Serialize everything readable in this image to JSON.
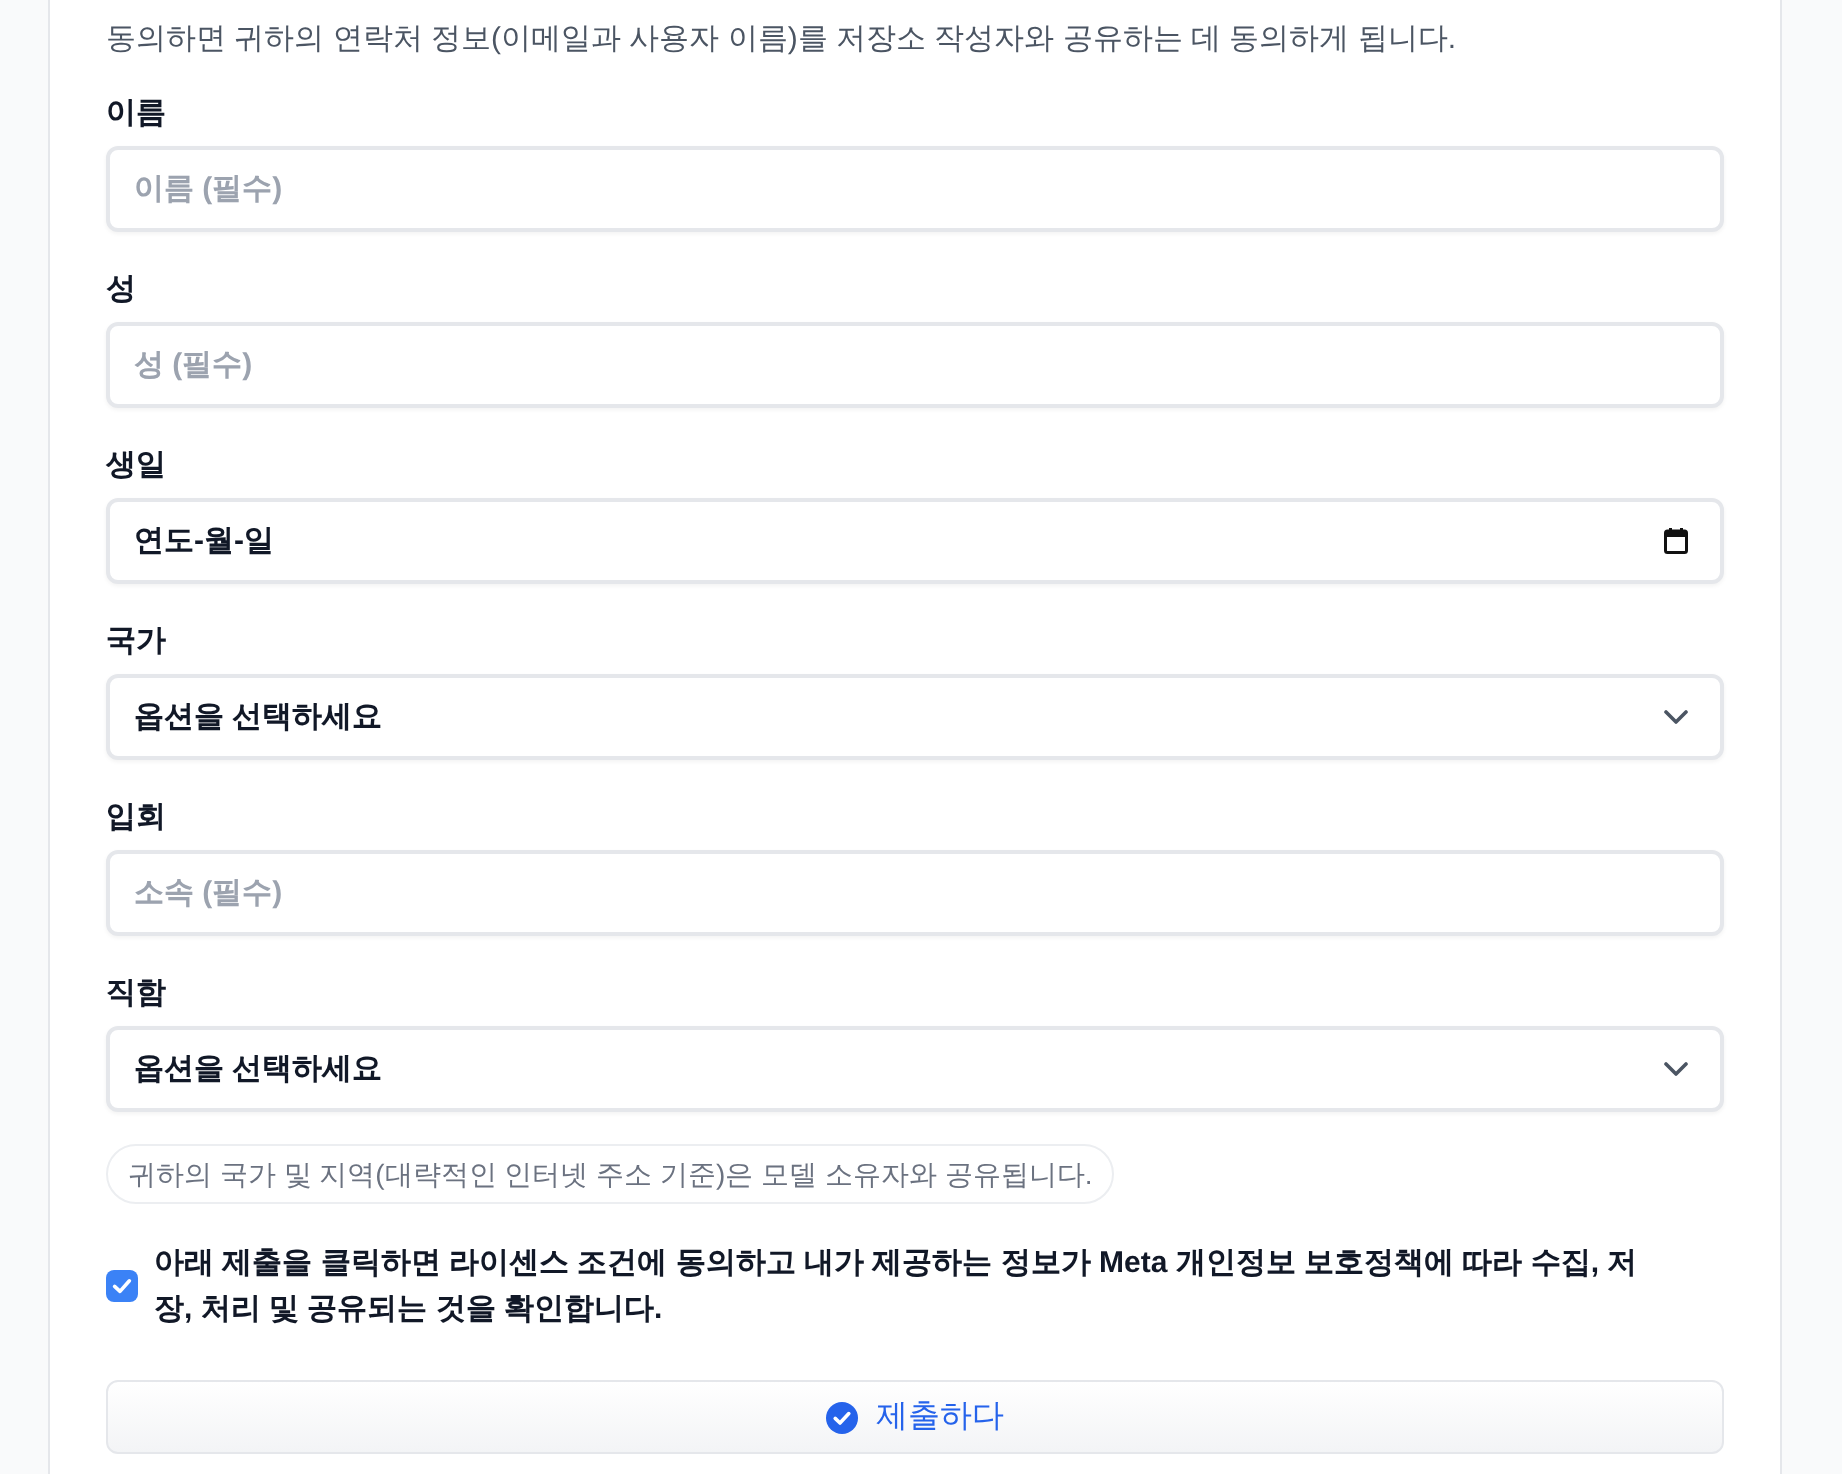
{
  "intro": "동의하면 귀하의 연락처 정보(이메일과 사용자 이름)를 저장소 작성자와 공유하는 데 동의하게 됩니다.",
  "fields": [
    {
      "kind": "text",
      "label": "이름",
      "placeholder": "이름 (필수)"
    },
    {
      "kind": "text",
      "label": "성",
      "placeholder": "성 (필수)"
    },
    {
      "kind": "date",
      "label": "생일",
      "value": "연도-월-일"
    },
    {
      "kind": "select",
      "label": "국가",
      "value": "옵션을 선택하세요"
    },
    {
      "kind": "text",
      "label": "입회",
      "placeholder": "소속 (필수)"
    },
    {
      "kind": "select",
      "label": "직함",
      "value": "옵션을 선택하세요"
    }
  ],
  "note": "귀하의 국가 및 지역(대략적인 인터넷 주소 기준)은 모델 소유자와 공유됩니다.",
  "consent": {
    "checked": true,
    "text": "아래 제출을 클릭하면 라이센스 조건에 동의하고 내가 제공하는 정보가 Meta 개인정보 보호정책에 따라 수집, 저장, 처리 및 공유되는 것을 확인합니다."
  },
  "submit": {
    "label": "제출하다"
  }
}
